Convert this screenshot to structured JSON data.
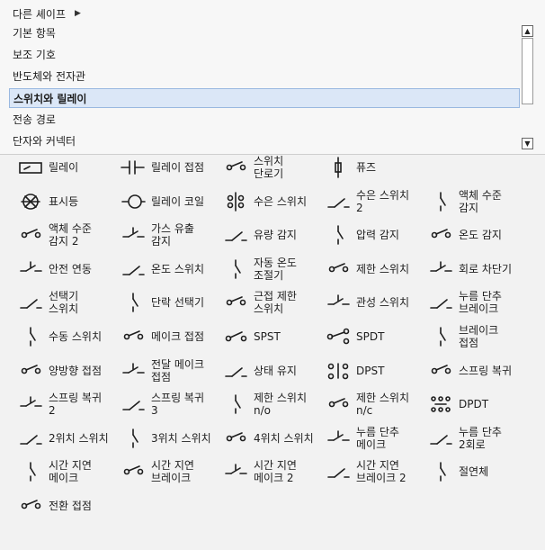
{
  "more_shapes": {
    "label": "다른 셰이프",
    "arrow": "▶"
  },
  "categories": [
    {
      "label": "기본 항목",
      "selected": false
    },
    {
      "label": "보조 기호",
      "selected": false
    },
    {
      "label": "반도체와 전자관",
      "selected": false
    },
    {
      "label": "스위치와 릴레이",
      "selected": true
    },
    {
      "label": "전송 경로",
      "selected": false
    },
    {
      "label": "단자와 커넥터",
      "selected": false
    }
  ],
  "scrollbar": {
    "up": "▲",
    "down": "▼"
  },
  "shapes": [
    {
      "label": "릴레이",
      "icon": "relay-icon"
    },
    {
      "label": "릴레이 접점",
      "icon": "relay-contact-icon"
    },
    {
      "label": "스위치\n단로기",
      "icon": "switch-disconnector-icon"
    },
    {
      "label": "퓨즈",
      "icon": "fuse-icon"
    },
    {
      "label": "",
      "icon": ""
    },
    {
      "label": "표시등",
      "icon": "indicator-lamp-icon"
    },
    {
      "label": "릴레이 코일",
      "icon": "relay-coil-icon"
    },
    {
      "label": "수은 스위치",
      "icon": "mercury-switch-icon"
    },
    {
      "label": "수은 스위치\n2",
      "icon": "mercury-switch-2-icon"
    },
    {
      "label": "액체 수준\n감지",
      "icon": "liquid-level-sensor-icon"
    },
    {
      "label": "액체 수준\n감지 2",
      "icon": "liquid-level-sensor-2-icon"
    },
    {
      "label": "가스 유출\n감지",
      "icon": "gas-leak-sensor-icon"
    },
    {
      "label": "유량 감지",
      "icon": "flow-sensor-icon"
    },
    {
      "label": "압력 감지",
      "icon": "pressure-sensor-icon"
    },
    {
      "label": "온도 감지",
      "icon": "temperature-sensor-icon"
    },
    {
      "label": "안전 연동",
      "icon": "safety-interlock-icon"
    },
    {
      "label": "온도 스위치",
      "icon": "temperature-switch-icon"
    },
    {
      "label": "자동 온도\n조절기",
      "icon": "thermostat-icon"
    },
    {
      "label": "제한 스위치",
      "icon": "limit-switch-icon"
    },
    {
      "label": "회로 차단기",
      "icon": "circuit-breaker-icon"
    },
    {
      "label": "선택기\n스위치",
      "icon": "selector-switch-icon"
    },
    {
      "label": "단락 선택기",
      "icon": "shorting-selector-icon"
    },
    {
      "label": "근접 제한\n스위치",
      "icon": "proximity-limit-switch-icon"
    },
    {
      "label": "관성 스위치",
      "icon": "inertia-switch-icon"
    },
    {
      "label": "누름 단추\n브레이크",
      "icon": "pushbutton-break-icon"
    },
    {
      "label": "수동 스위치",
      "icon": "manual-switch-icon"
    },
    {
      "label": "메이크 접점",
      "icon": "make-contact-icon"
    },
    {
      "label": "SPST",
      "icon": "spst-icon"
    },
    {
      "label": "SPDT",
      "icon": "spdt-icon"
    },
    {
      "label": "브레이크\n접점",
      "icon": "break-contact-icon"
    },
    {
      "label": "양방향 접점",
      "icon": "two-way-contact-icon"
    },
    {
      "label": "전달 메이크\n접점",
      "icon": "transfer-make-contact-icon"
    },
    {
      "label": "상태 유지",
      "icon": "maintained-icon"
    },
    {
      "label": "DPST",
      "icon": "dpst-icon"
    },
    {
      "label": "스프링 복귀",
      "icon": "spring-return-icon"
    },
    {
      "label": "스프링 복귀\n2",
      "icon": "spring-return-2-icon"
    },
    {
      "label": "스프링 복귀\n3",
      "icon": "spring-return-3-icon"
    },
    {
      "label": "제한 스위치\nn/o",
      "icon": "limit-switch-no-icon"
    },
    {
      "label": "제한 스위치\nn/c",
      "icon": "limit-switch-nc-icon"
    },
    {
      "label": "DPDT",
      "icon": "dpdt-icon"
    },
    {
      "label": "2위치 스위치",
      "icon": "two-position-switch-icon"
    },
    {
      "label": "3위치 스위치",
      "icon": "three-position-switch-icon"
    },
    {
      "label": "4위치 스위치",
      "icon": "four-position-switch-icon"
    },
    {
      "label": "누름 단추\n메이크",
      "icon": "pushbutton-make-icon"
    },
    {
      "label": "누름 단추\n2회로",
      "icon": "pushbutton-two-circuit-icon"
    },
    {
      "label": "시간 지연\n메이크",
      "icon": "time-delay-make-icon"
    },
    {
      "label": "시간 지연\n브레이크",
      "icon": "time-delay-break-icon"
    },
    {
      "label": "시간 지연\n메이크 2",
      "icon": "time-delay-make-2-icon"
    },
    {
      "label": "시간 지연\n브레이크 2",
      "icon": "time-delay-break-2-icon"
    },
    {
      "label": "절연체",
      "icon": "insulator-icon"
    },
    {
      "label": "전환 접점",
      "icon": "changeover-contact-icon"
    }
  ]
}
